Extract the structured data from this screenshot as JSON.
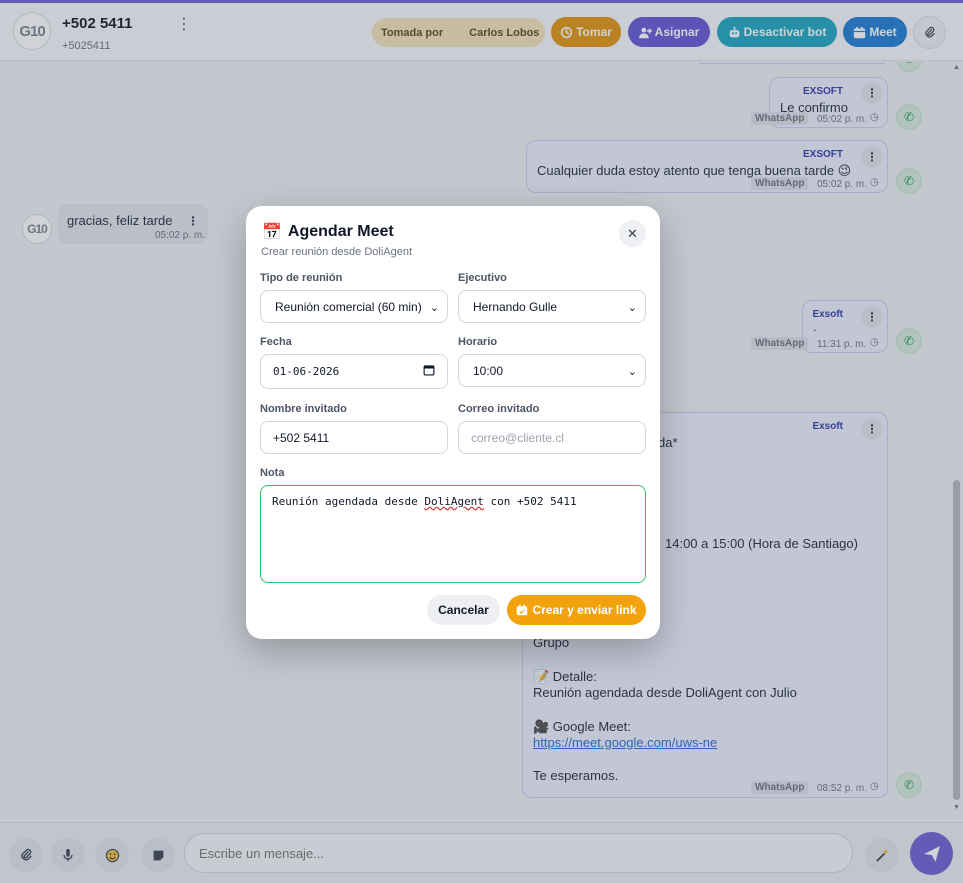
{
  "header": {
    "avatar_text": "G10",
    "contact_name": "+502 5411",
    "contact_phone": "+5025411",
    "taken_label": "Tomada por",
    "taken_by": "Carlos Lobos",
    "btn_tomar": "Tomar",
    "btn_asignar": "Asignar",
    "btn_bot": "Desactivar bot",
    "btn_meet": "Meet"
  },
  "messages": {
    "m1": {
      "sender": "EXSOFT",
      "text": "Le confirmo",
      "channel": "WhatsApp",
      "time": "05:02 p. m."
    },
    "m2": {
      "sender": "EXSOFT",
      "text": "Cualquier duda estoy atento que tenga buena tarde 😉",
      "channel": "WhatsApp",
      "time": "05:02 p. m."
    },
    "m3": {
      "avatar_text": "G10",
      "text": "gracias, feliz tarde",
      "time": "05:02 p. m."
    },
    "m4": {
      "sender": "Exsoft",
      "text": ".",
      "channel": "WhatsApp",
      "time": "11:31 p. m."
    },
    "m5": {
      "sender": "Exsoft",
      "line_a": "da*",
      "line_b": "14:00 a 15:00 (Hora de Santiago)",
      "line_c": "Grupo",
      "detail_label": "📝 Detalle:",
      "detail_text": "Reunión agendada desde DoliAgent con Julio",
      "meet_label": "🎥 Google Meet:",
      "meet_link": "https://meet.google.com/uws-ne",
      "closing": "Te esperamos.",
      "channel": "WhatsApp",
      "time": "08:52 p. m."
    }
  },
  "footer": {
    "placeholder": "Escribe un mensaje..."
  },
  "modal": {
    "icon": "📅",
    "title": "Agendar Meet",
    "subtitle": "Crear reunión desde DoliAgent",
    "meeting_type_label": "Tipo de reunión",
    "meeting_type_value": "Reunión comercial (60 min)",
    "executive_label": "Ejecutivo",
    "executive_value": "Hernando Gulle",
    "date_label": "Fecha",
    "date_value": "01-06-2026",
    "time_label": "Horario",
    "time_value": "10:00",
    "guest_name_label": "Nombre invitado",
    "guest_name_value": "+502 5411",
    "guest_email_label": "Correo invitado",
    "guest_email_placeholder": "correo@cliente.cl",
    "note_label": "Nota",
    "note_prefix": "Reunión agendada desde ",
    "note_flagged": "DoliAgent",
    "note_suffix": " con +502 5411",
    "cancel_label": "Cancelar",
    "create_label": "Crear y enviar link"
  }
}
